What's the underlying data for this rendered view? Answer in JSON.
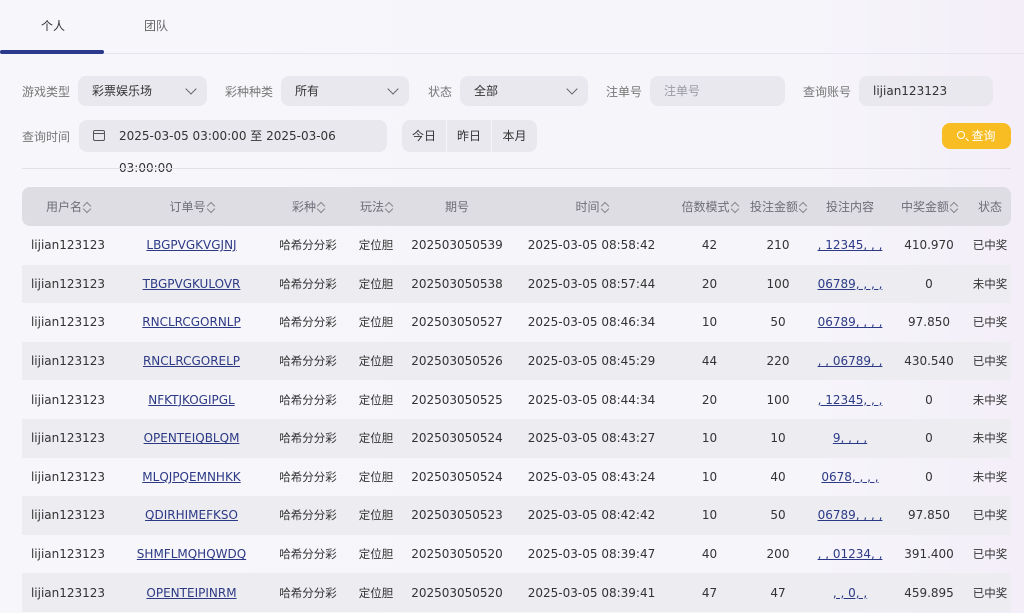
{
  "tabs": [
    {
      "label": "个人"
    },
    {
      "label": "团队"
    }
  ],
  "filters": {
    "game_type_label": "游戏类型",
    "game_type_value": "彩票娱乐场",
    "lottery_label": "彩种种类",
    "lottery_value": "所有",
    "status_label": "状态",
    "status_value": "全部",
    "order_label": "注单号",
    "order_placeholder": "注单号",
    "account_label": "查询账号",
    "account_value": "lijian123123",
    "time_label": "查询时间",
    "time_range": "2025-03-05 03:00:00 至 2025-03-06 03:00:00",
    "today": "今日",
    "yesterday": "昨日",
    "this_month": "本月",
    "query": "查询"
  },
  "table": {
    "headers": [
      "用户名",
      "订单号",
      "彩种",
      "玩法",
      "期号",
      "时间",
      "倍数模式",
      "投注金额",
      "投注内容",
      "中奖金额",
      "状态"
    ],
    "rows": [
      {
        "user": "lijian123123",
        "order": "LBGPVGKVGJNJ",
        "lottery": "哈希分分彩",
        "play": "定位胆",
        "issue": "202503050539",
        "time": "2025-03-05 08:58:42",
        "multiple": "42",
        "amount": "210",
        "content": ", 12345, , ,",
        "win": "410.970",
        "status": "已中奖"
      },
      {
        "user": "lijian123123",
        "order": "TBGPVGKULOVR",
        "lottery": "哈希分分彩",
        "play": "定位胆",
        "issue": "202503050538",
        "time": "2025-03-05 08:57:44",
        "multiple": "20",
        "amount": "100",
        "content": "06789, , , ,",
        "win": "0",
        "status": "未中奖"
      },
      {
        "user": "lijian123123",
        "order": "RNCLRCGORNLP",
        "lottery": "哈希分分彩",
        "play": "定位胆",
        "issue": "202503050527",
        "time": "2025-03-05 08:46:34",
        "multiple": "10",
        "amount": "50",
        "content": "06789, , , ,",
        "win": "97.850",
        "status": "已中奖"
      },
      {
        "user": "lijian123123",
        "order": "RNCLRCGORELP",
        "lottery": "哈希分分彩",
        "play": "定位胆",
        "issue": "202503050526",
        "time": "2025-03-05 08:45:29",
        "multiple": "44",
        "amount": "220",
        "content": ", , 06789, ,",
        "win": "430.540",
        "status": "已中奖"
      },
      {
        "user": "lijian123123",
        "order": "NFKTJKOGIPGL",
        "lottery": "哈希分分彩",
        "play": "定位胆",
        "issue": "202503050525",
        "time": "2025-03-05 08:44:34",
        "multiple": "20",
        "amount": "100",
        "content": ", 12345, , ,",
        "win": "0",
        "status": "未中奖"
      },
      {
        "user": "lijian123123",
        "order": "OPENTEIQBLQM",
        "lottery": "哈希分分彩",
        "play": "定位胆",
        "issue": "202503050524",
        "time": "2025-03-05 08:43:27",
        "multiple": "10",
        "amount": "10",
        "content": "9, , , ,",
        "win": "0",
        "status": "未中奖"
      },
      {
        "user": "lijian123123",
        "order": "MLQJPQEMNHKK",
        "lottery": "哈希分分彩",
        "play": "定位胆",
        "issue": "202503050524",
        "time": "2025-03-05 08:43:24",
        "multiple": "10",
        "amount": "40",
        "content": "0678, , , ,",
        "win": "0",
        "status": "未中奖"
      },
      {
        "user": "lijian123123",
        "order": "QDIRHIMEFKSO",
        "lottery": "哈希分分彩",
        "play": "定位胆",
        "issue": "202503050523",
        "time": "2025-03-05 08:42:42",
        "multiple": "10",
        "amount": "50",
        "content": "06789, , , ,",
        "win": "97.850",
        "status": "已中奖"
      },
      {
        "user": "lijian123123",
        "order": "SHMFLMQHQWDQ",
        "lottery": "哈希分分彩",
        "play": "定位胆",
        "issue": "202503050520",
        "time": "2025-03-05 08:39:47",
        "multiple": "40",
        "amount": "200",
        "content": ", , 01234, ,",
        "win": "391.400",
        "status": "已中奖"
      },
      {
        "user": "lijian123123",
        "order": "OPENTEIPINRM",
        "lottery": "哈希分分彩",
        "play": "定位胆",
        "issue": "202503050520",
        "time": "2025-03-05 08:39:41",
        "multiple": "47",
        "amount": "47",
        "content": ", , 0, ,",
        "win": "459.895",
        "status": "已中奖"
      }
    ]
  },
  "colors": {
    "accent": "#2b3a8c",
    "query_button": "#f7bd22",
    "header_bg": "#dedde3"
  }
}
